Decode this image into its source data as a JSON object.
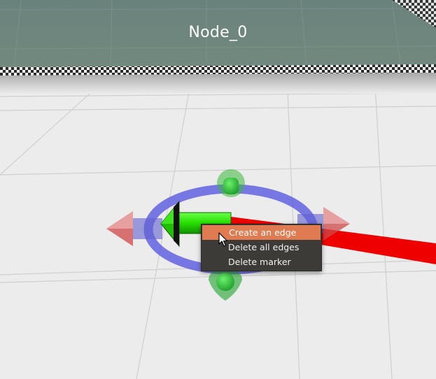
{
  "node": {
    "title": "Node_0"
  },
  "context_menu": {
    "items": [
      {
        "label": "Create an edge",
        "active": true
      },
      {
        "label": "Delete all edges",
        "active": false
      },
      {
        "label": "Delete marker",
        "active": false
      }
    ],
    "highlight_color": "#e07a50",
    "background_color": "#3c3b37"
  },
  "colors": {
    "node_box": "#6e8780",
    "floor": "#ececec",
    "grid": "#cfcfcf",
    "x_axis": "#ee0000",
    "direction_arrow": "#22dd00",
    "rotation_ring": "#4a4ad8"
  }
}
